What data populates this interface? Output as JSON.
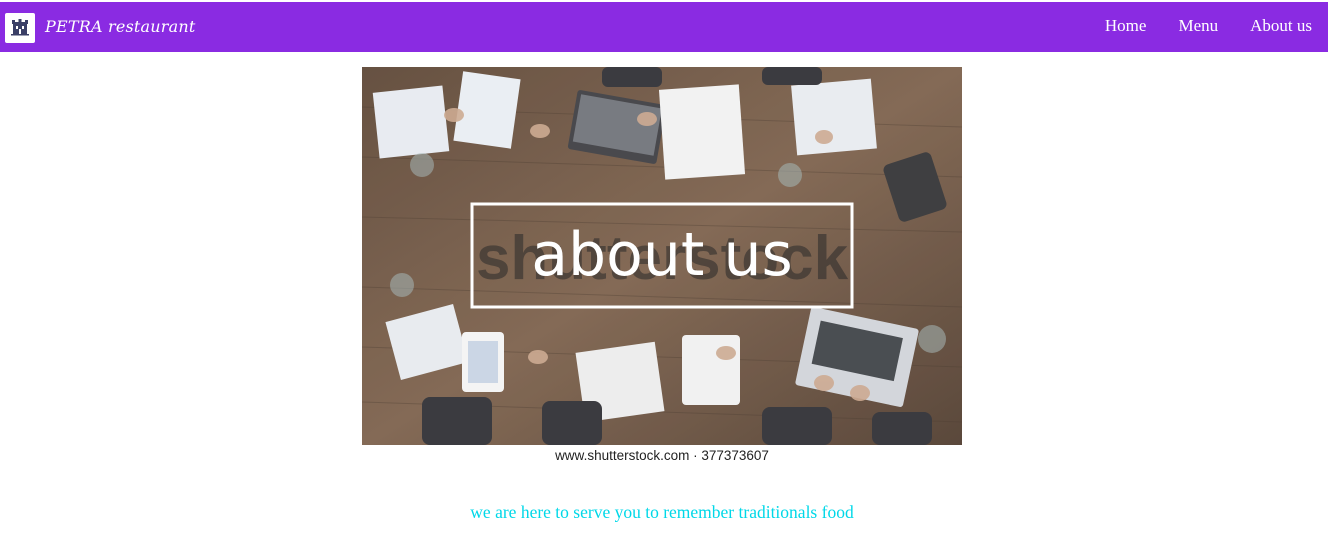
{
  "navbar": {
    "brand": "PETRA restaurant",
    "logo_icon": "building-logo-icon",
    "links": [
      {
        "label": "Home"
      },
      {
        "label": "Menu"
      },
      {
        "label": "About us"
      }
    ],
    "background": "#8a2be2"
  },
  "hero": {
    "heading": "about us",
    "watermark": "shutterstock",
    "credit": "www.shutterstock.com · 377373607"
  },
  "tagline": "we are here to serve you to remember traditionals food",
  "colors": {
    "accent": "#8a2be2",
    "tagline": "#00d8e8"
  }
}
